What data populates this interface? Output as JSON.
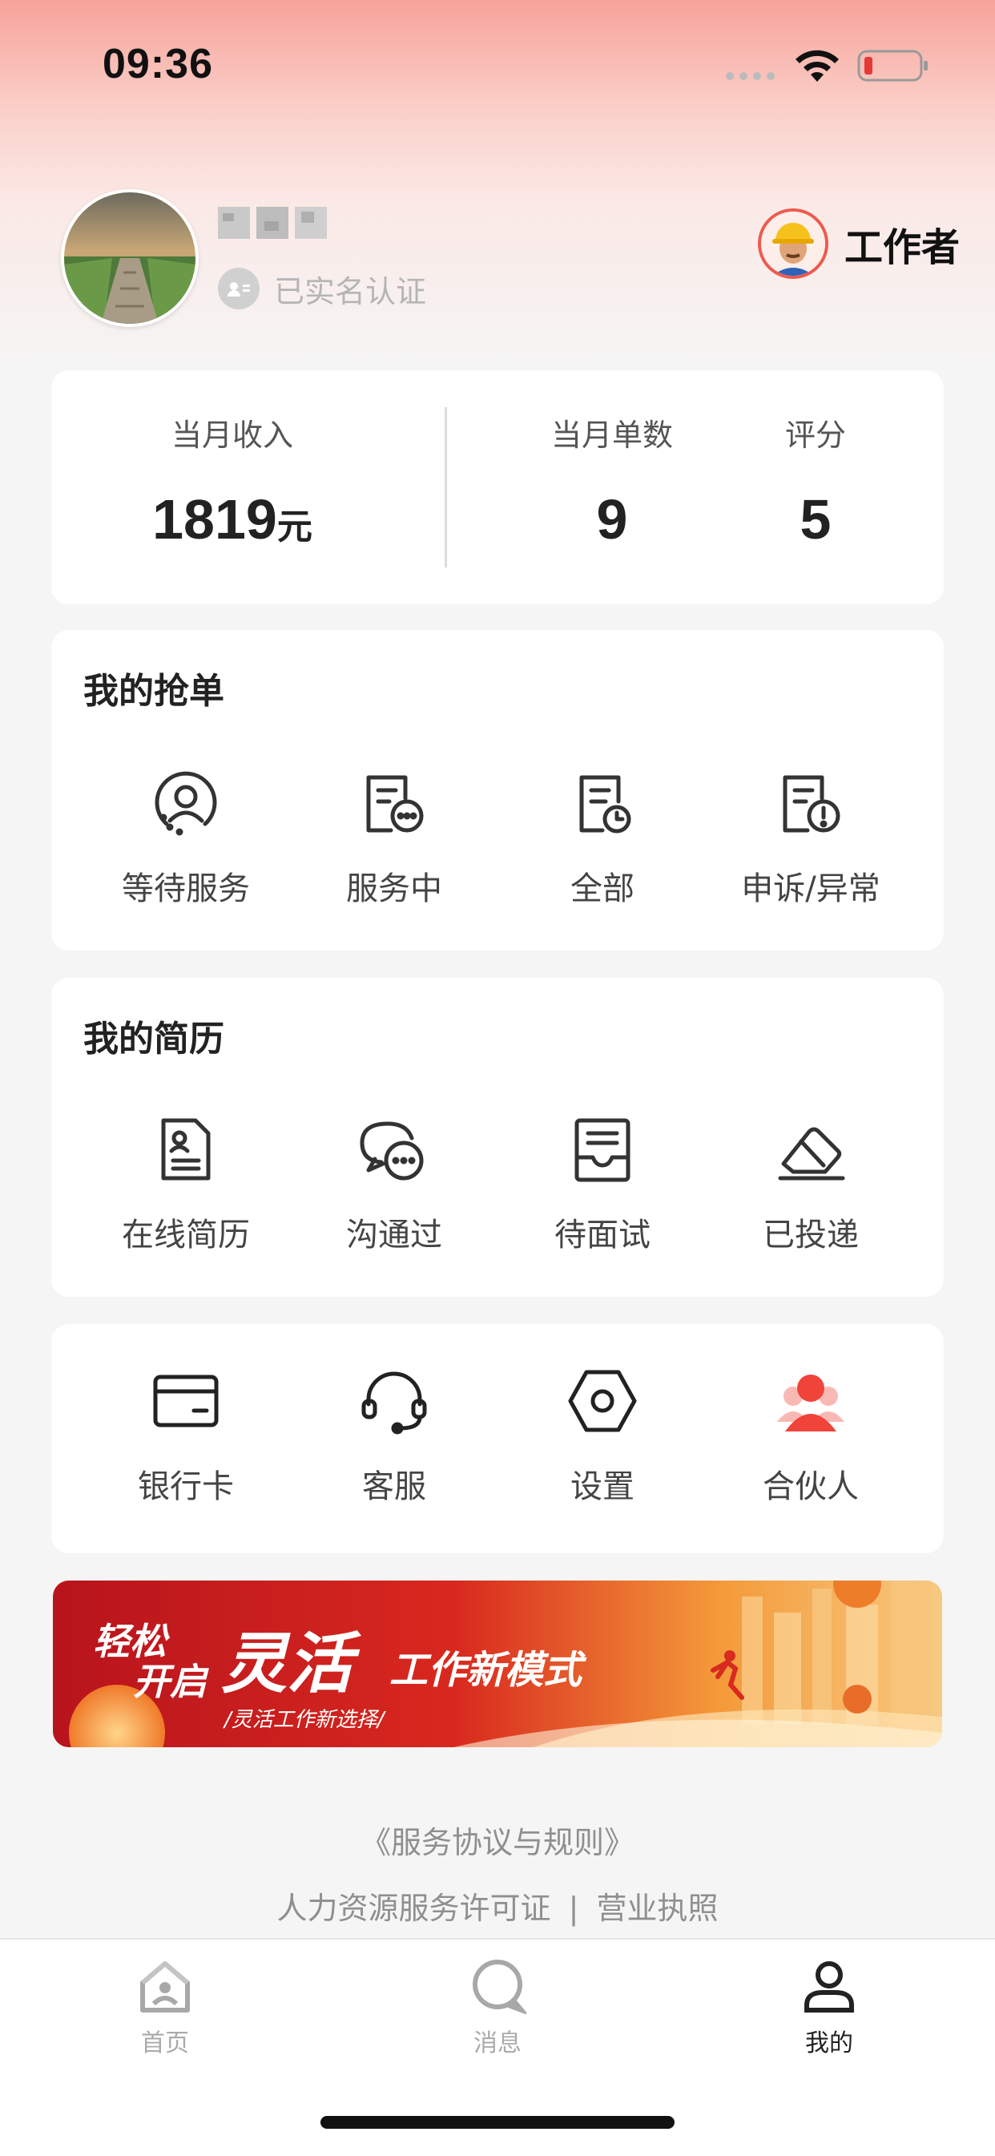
{
  "status_bar": {
    "time": "09:36"
  },
  "profile": {
    "verified_text": "已实名认证",
    "role_label": "工作者"
  },
  "stats": {
    "income_label": "当月收入",
    "income_value": "1819",
    "income_unit": "元",
    "orders_label": "当月单数",
    "orders_value": "9",
    "rating_label": "评分",
    "rating_value": "5"
  },
  "my_orders": {
    "title": "我的抢单",
    "items": [
      {
        "label": "等待服务",
        "icon": "user-circle-icon"
      },
      {
        "label": "服务中",
        "icon": "document-chat-icon"
      },
      {
        "label": "全部",
        "icon": "document-clock-icon"
      },
      {
        "label": "申诉/异常",
        "icon": "document-alert-icon"
      }
    ]
  },
  "my_resume": {
    "title": "我的简历",
    "items": [
      {
        "label": "在线简历",
        "icon": "resume-icon"
      },
      {
        "label": "沟通过",
        "icon": "chat-bubbles-icon"
      },
      {
        "label": "待面试",
        "icon": "inbox-tray-icon"
      },
      {
        "label": "已投递",
        "icon": "eraser-icon"
      }
    ]
  },
  "tools": {
    "items": [
      {
        "label": "银行卡",
        "icon": "bank-card-icon"
      },
      {
        "label": "客服",
        "icon": "headset-icon"
      },
      {
        "label": "设置",
        "icon": "settings-hexagon-icon"
      },
      {
        "label": "合伙人",
        "icon": "partner-icon"
      }
    ]
  },
  "banner": {
    "headline_a": "轻松",
    "headline_b": "开启",
    "headline_big": "灵活",
    "headline_c": "工作新模式",
    "subline": "/灵活工作新选择/"
  },
  "footer": {
    "agreement_link": "《服务协议与规则》",
    "license_link": "人力资源服务许可证",
    "separator": "|",
    "business_license_link": "营业执照"
  },
  "tabbar": {
    "items": [
      {
        "label": "首页",
        "icon": "home-icon",
        "active": false
      },
      {
        "label": "消息",
        "icon": "message-icon",
        "active": false
      },
      {
        "label": "我的",
        "icon": "profile-icon",
        "active": true
      }
    ]
  },
  "colors": {
    "accent": "#ee5a4e",
    "header_gradient_top": "#f6a39a",
    "text_primary": "#222222",
    "text_muted": "#8f8f8f"
  }
}
